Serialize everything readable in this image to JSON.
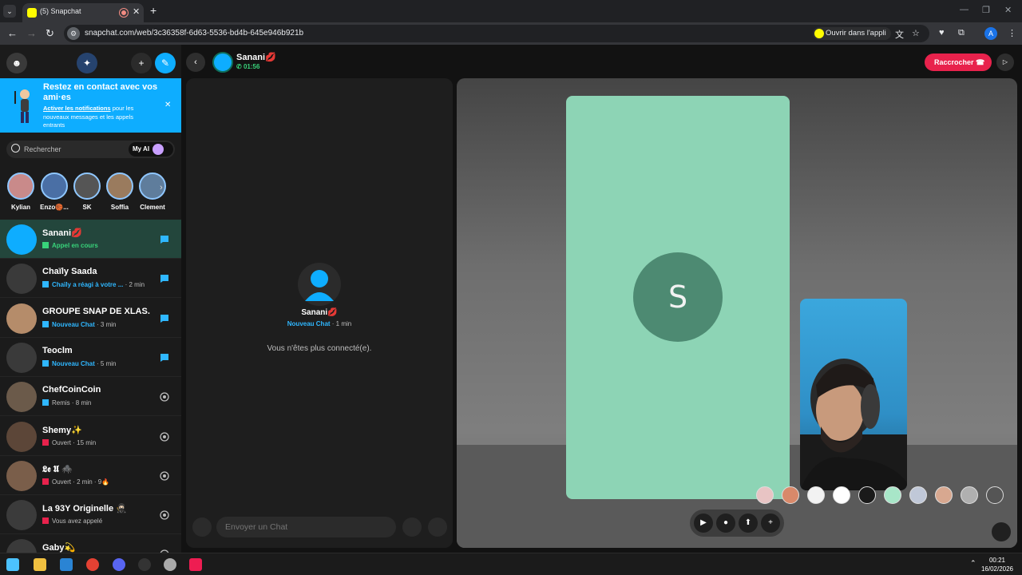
{
  "browser": {
    "tab_title": "(5) Snapchat",
    "tab_close": "✕",
    "new_tab": "+",
    "url": "snapchat.com/web/3c36358f-6d63-5536-bd4b-645e946b921b",
    "open_in_app": "Ouvrir dans l'appli",
    "profile_initial": "A"
  },
  "sidebar": {
    "banner": {
      "title": "Restez en contact avec vos ami·es",
      "link": "Activer les notifications",
      "body": " pour les nouveaux messages et les appels entrants",
      "close": "✕"
    },
    "search": {
      "placeholder": "Rechercher",
      "my_ai": "My AI"
    },
    "stories": [
      {
        "name": "Kylian",
        "color": "#c98a8a"
      },
      {
        "name": "Enzo🏀...",
        "color": "#4a6fa5"
      },
      {
        "name": "SK",
        "color": "#555555"
      },
      {
        "name": "Soffia",
        "color": "#9a7b5e"
      },
      {
        "name": "Clement",
        "color": "#5f7d9c"
      }
    ],
    "chats": [
      {
        "name": "Sanani💋",
        "status": "Appel en cours",
        "time": "",
        "kind": "call",
        "avatar_color": "#0eadff"
      },
      {
        "name": "Chaïly Saada",
        "status": "Chaïly a réagi à votre ...",
        "time": " · 2 min",
        "kind": "blue",
        "avatar_color": "#3a3a3a"
      },
      {
        "name": "GROUPE SNAP DE XLAS...",
        "status": "Nouveau Chat",
        "time": " · 3 min",
        "kind": "blue",
        "avatar_color": "#b58c6a"
      },
      {
        "name": "Teoclm",
        "status": "Nouveau Chat",
        "time": " · 5 min",
        "kind": "blue",
        "avatar_color": "#3a3a3a"
      },
      {
        "name": "ChefCoinCoin",
        "status": "Remis",
        "time": " · 8 min",
        "kind": "grey",
        "avatar_color": "#6b5a4a"
      },
      {
        "name": "Shemy✨",
        "status": "Ouvert",
        "time": " · 15 min",
        "kind": "grey",
        "avatar_color": "#5c4638"
      },
      {
        "name": "𝕷𝖊 𝖀 🕷️",
        "status": "Ouvert",
        "time": " · 2 min · 9🔥",
        "kind": "grey",
        "avatar_color": "#7a5e4a"
      },
      {
        "name": "La 93Y Originelle 🥷🏻",
        "status": "Vous avez appelé",
        "time": "",
        "kind": "grey",
        "avatar_color": "#3b3b3b"
      },
      {
        "name": "Gaby💫",
        "status": "",
        "time": "",
        "kind": "grey",
        "avatar_color": "#3a3a3a"
      }
    ]
  },
  "header": {
    "name": "Sanani💋",
    "timer": "01:56",
    "hangup": "Raccrocher"
  },
  "chat": {
    "name": "Sanani💋",
    "status": "Nouveau Chat",
    "time": " · 1 min",
    "disconnected": "Vous n'êtes plus connecté(e).",
    "composer_placeholder": "Envoyer un Chat"
  },
  "call": {
    "remote_initial": "S",
    "remote_bg": "#8dd4b5"
  },
  "taskbar": {
    "time": "00:21",
    "date": "16/02/2026"
  }
}
